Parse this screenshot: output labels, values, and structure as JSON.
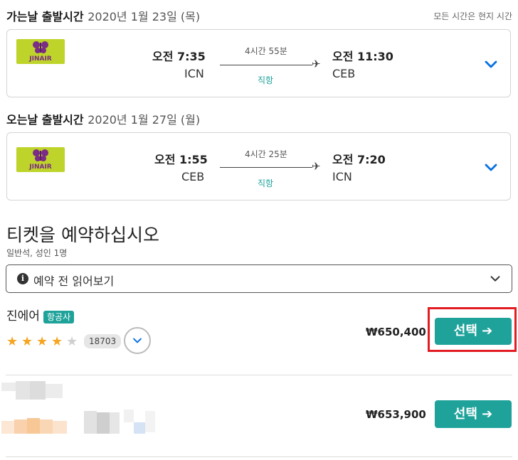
{
  "outbound": {
    "heading": "가는날 출발시간",
    "date": "2020년 1월 23일 (목)",
    "timezone_note": "모든 시간은 현지 시간",
    "airline_logo": "JINAIR",
    "depart_time": "오전 7:35",
    "depart_airport": "ICN",
    "duration": "4시간 55분",
    "stops": "직항",
    "arrive_time": "오전 11:30",
    "arrive_airport": "CEB"
  },
  "inbound": {
    "heading": "오는날 출발시간",
    "date": "2020년 1월 27일 (월)",
    "airline_logo": "JINAIR",
    "depart_time": "오전 1:55",
    "depart_airport": "CEB",
    "duration": "4시간 25분",
    "stops": "직항",
    "arrive_time": "오전 7:20",
    "arrive_airport": "ICN"
  },
  "booking": {
    "title": "티켓을 예약하십시오",
    "subtitle": "일반석, 성인 1명",
    "info_label": "예약 전 읽어보기"
  },
  "offers": [
    {
      "provider": "진에어",
      "badge": "항공사",
      "rating": 4,
      "rating_max": 5,
      "review_count": "18703",
      "price": "₩650,400",
      "select_label": "선택 ➔",
      "highlighted": true
    },
    {
      "provider": "",
      "price": "₩653,900",
      "select_label": "선택 ➔"
    }
  ],
  "colors": {
    "accent": "#1ea29a",
    "highlight": "#e31b23",
    "chevron": "#0770e3",
    "star_on": "#f5a623",
    "star_off": "#cfcfcf"
  }
}
